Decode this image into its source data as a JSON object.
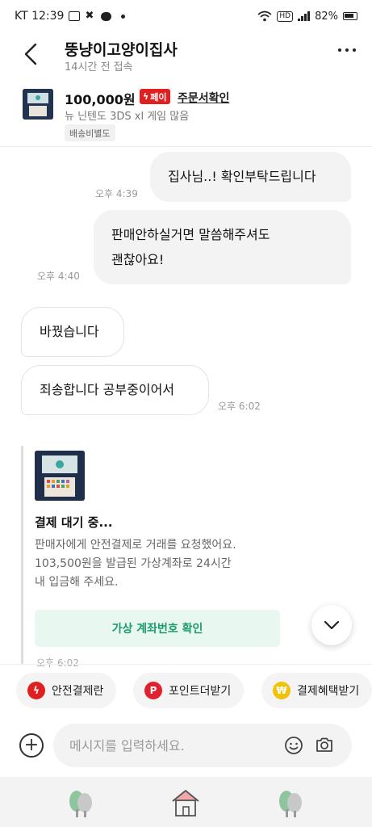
{
  "status_bar": {
    "carrier_time": "KT 12:39",
    "battery": "82%"
  },
  "header": {
    "title": "뚱냥이고양이집사",
    "subtitle": "14시간 전 접속"
  },
  "product": {
    "price": "100,000원",
    "pay_badge": "페이",
    "order_link": "주문서확인",
    "name": "뉴 닌텐도 3DS xl 게임 많음",
    "shipping": "배송비별도"
  },
  "messages": [
    {
      "text": "집사님..! 확인부탁드립니다",
      "time": "오후 4:39"
    },
    {
      "line1": "판매안하실거면 말씀해주셔도",
      "line2": "괜찮아요!",
      "time": "오후 4:40"
    },
    {
      "text": "바꿨습니다"
    },
    {
      "text": "죄송합니다 공부중이어서",
      "time": "오후 6:02"
    }
  ],
  "payment_card": {
    "title": "결제 대기 중...",
    "desc_line1": "판매자에게 안전결제로 거래를 요청했어요.",
    "desc_line2": "103,500원을 발급된 가상계좌로 24시간",
    "desc_line3": "내 입금해 주세요.",
    "button": "가상 계좌번호 확인",
    "time": "오후 6:02"
  },
  "quick_actions": [
    {
      "label": "안전결제란",
      "color": "#e02020"
    },
    {
      "label": "포인트더받기",
      "color": "#e0202e"
    },
    {
      "label": "결제혜택받기",
      "color": "#f0c20a"
    }
  ],
  "input": {
    "placeholder": "메시지를 입력하세요."
  },
  "colors": {
    "accent_green": "#1d9b6b",
    "pay_red": "#e02020"
  }
}
